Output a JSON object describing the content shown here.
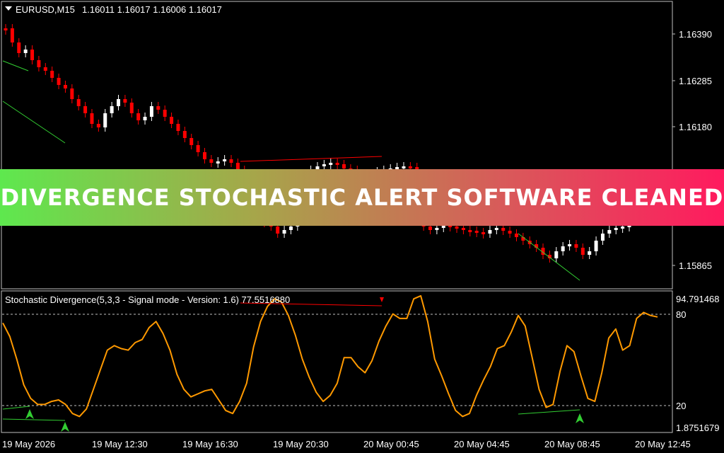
{
  "main_chart": {
    "symbol_label": "EURUSD,M15",
    "ohlc_label": "1.16011 1.16017 1.16006 1.16017",
    "price_ticks": [
      "1.16390",
      "1.16285",
      "1.16180",
      "1.15865"
    ]
  },
  "indicator": {
    "title": "Stochastic Divergence(5,3,3 - Signal mode - Version: 1.6) 77.5516880",
    "scale_max": "94.791468",
    "scale_min": "1.8751679",
    "level_high": "80",
    "level_low": "20"
  },
  "time_axis": [
    "19 May 2026",
    "19 May 12:30",
    "19 May 16:30",
    "19 May 20:30",
    "20 May 00:45",
    "20 May 04:45",
    "20 May 08:45",
    "20 May 12:45"
  ],
  "banner": {
    "text": "DIVERGENCE STOCHASTIC ALERT SOFTWARE CLEANED"
  },
  "colors": {
    "bull_candle": "#ffffff",
    "bear_candle": "#ff0000",
    "stochastic_line": "#ff9900",
    "bull_divergence": "#32cd32",
    "bear_divergence": "#ff0000"
  },
  "chart_data": {
    "type": "line",
    "series": [
      {
        "values": [
          74,
          65,
          50,
          33,
          24,
          20,
          20,
          22,
          23,
          20,
          14,
          12,
          17,
          30,
          43,
          56,
          59,
          57,
          56,
          61,
          63,
          71,
          75,
          67,
          56,
          40,
          30,
          25,
          27,
          29,
          30,
          23,
          16,
          14,
          22,
          34,
          58,
          75,
          85,
          90,
          88,
          79,
          66,
          50,
          38,
          28,
          22,
          26,
          34,
          51,
          51,
          45,
          41,
          49,
          62,
          72,
          80,
          77,
          77,
          90,
          92,
          75,
          50,
          39,
          27,
          16,
          12,
          14,
          26,
          36,
          45,
          57,
          59,
          68,
          79,
          72,
          51,
          30,
          18,
          20,
          42,
          59,
          55,
          39,
          24,
          22,
          41,
          64,
          70,
          56,
          59,
          77,
          81,
          79,
          78
        ]
      }
    ],
    "ylim": [
      1.8751679,
      94.791468
    ],
    "levels": [
      20,
      80
    ]
  }
}
